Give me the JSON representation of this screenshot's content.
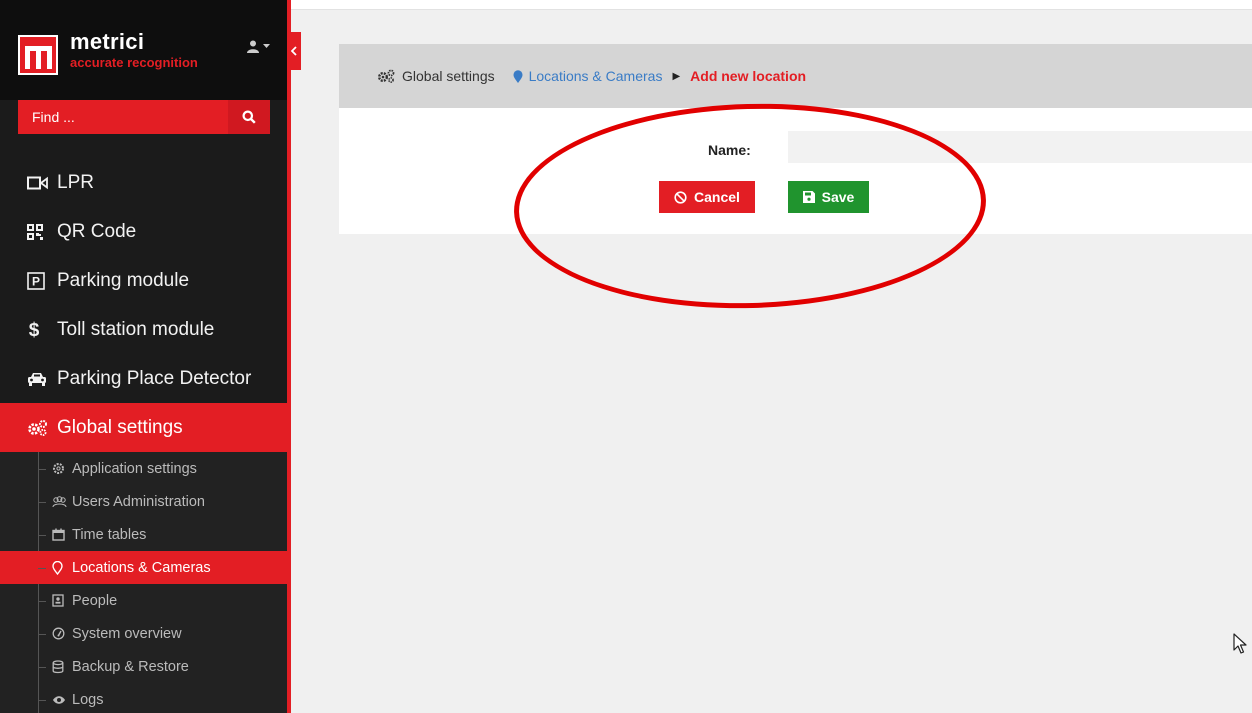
{
  "brand": {
    "name": "metrici",
    "tagline": "accurate recognition"
  },
  "search": {
    "placeholder": "Find ..."
  },
  "nav": {
    "items": [
      {
        "label": "LPR",
        "icon": "video-camera-icon"
      },
      {
        "label": "QR Code",
        "icon": "qrcode-icon"
      },
      {
        "label": "Parking module",
        "icon": "parking-icon"
      },
      {
        "label": "Toll station module",
        "icon": "dollar-icon"
      },
      {
        "label": "Parking Place Detector",
        "icon": "car-icon"
      },
      {
        "label": "Global settings",
        "icon": "gears-icon",
        "active": true
      }
    ],
    "sub_items": [
      {
        "label": "Application settings",
        "icon": "cog-icon"
      },
      {
        "label": "Users Administration",
        "icon": "users-icon"
      },
      {
        "label": "Time tables",
        "icon": "calendar-icon"
      },
      {
        "label": "Locations & Cameras",
        "icon": "map-marker-icon",
        "active": true
      },
      {
        "label": "People",
        "icon": "id-card-icon"
      },
      {
        "label": "System overview",
        "icon": "dashboard-icon"
      },
      {
        "label": "Backup & Restore",
        "icon": "database-icon"
      },
      {
        "label": "Logs",
        "icon": "eye-icon"
      }
    ]
  },
  "breadcrumb": {
    "root": "Global settings",
    "parent": "Locations & Cameras",
    "current": "Add new location"
  },
  "form": {
    "name_label": "Name:",
    "name_value": "",
    "cancel_label": "Cancel",
    "save_label": "Save"
  },
  "colors": {
    "accent": "#e31e24",
    "sidebar": "#1b1b1b",
    "save": "#20942e",
    "link": "#3a7cc6",
    "annotation": "#e10000"
  }
}
